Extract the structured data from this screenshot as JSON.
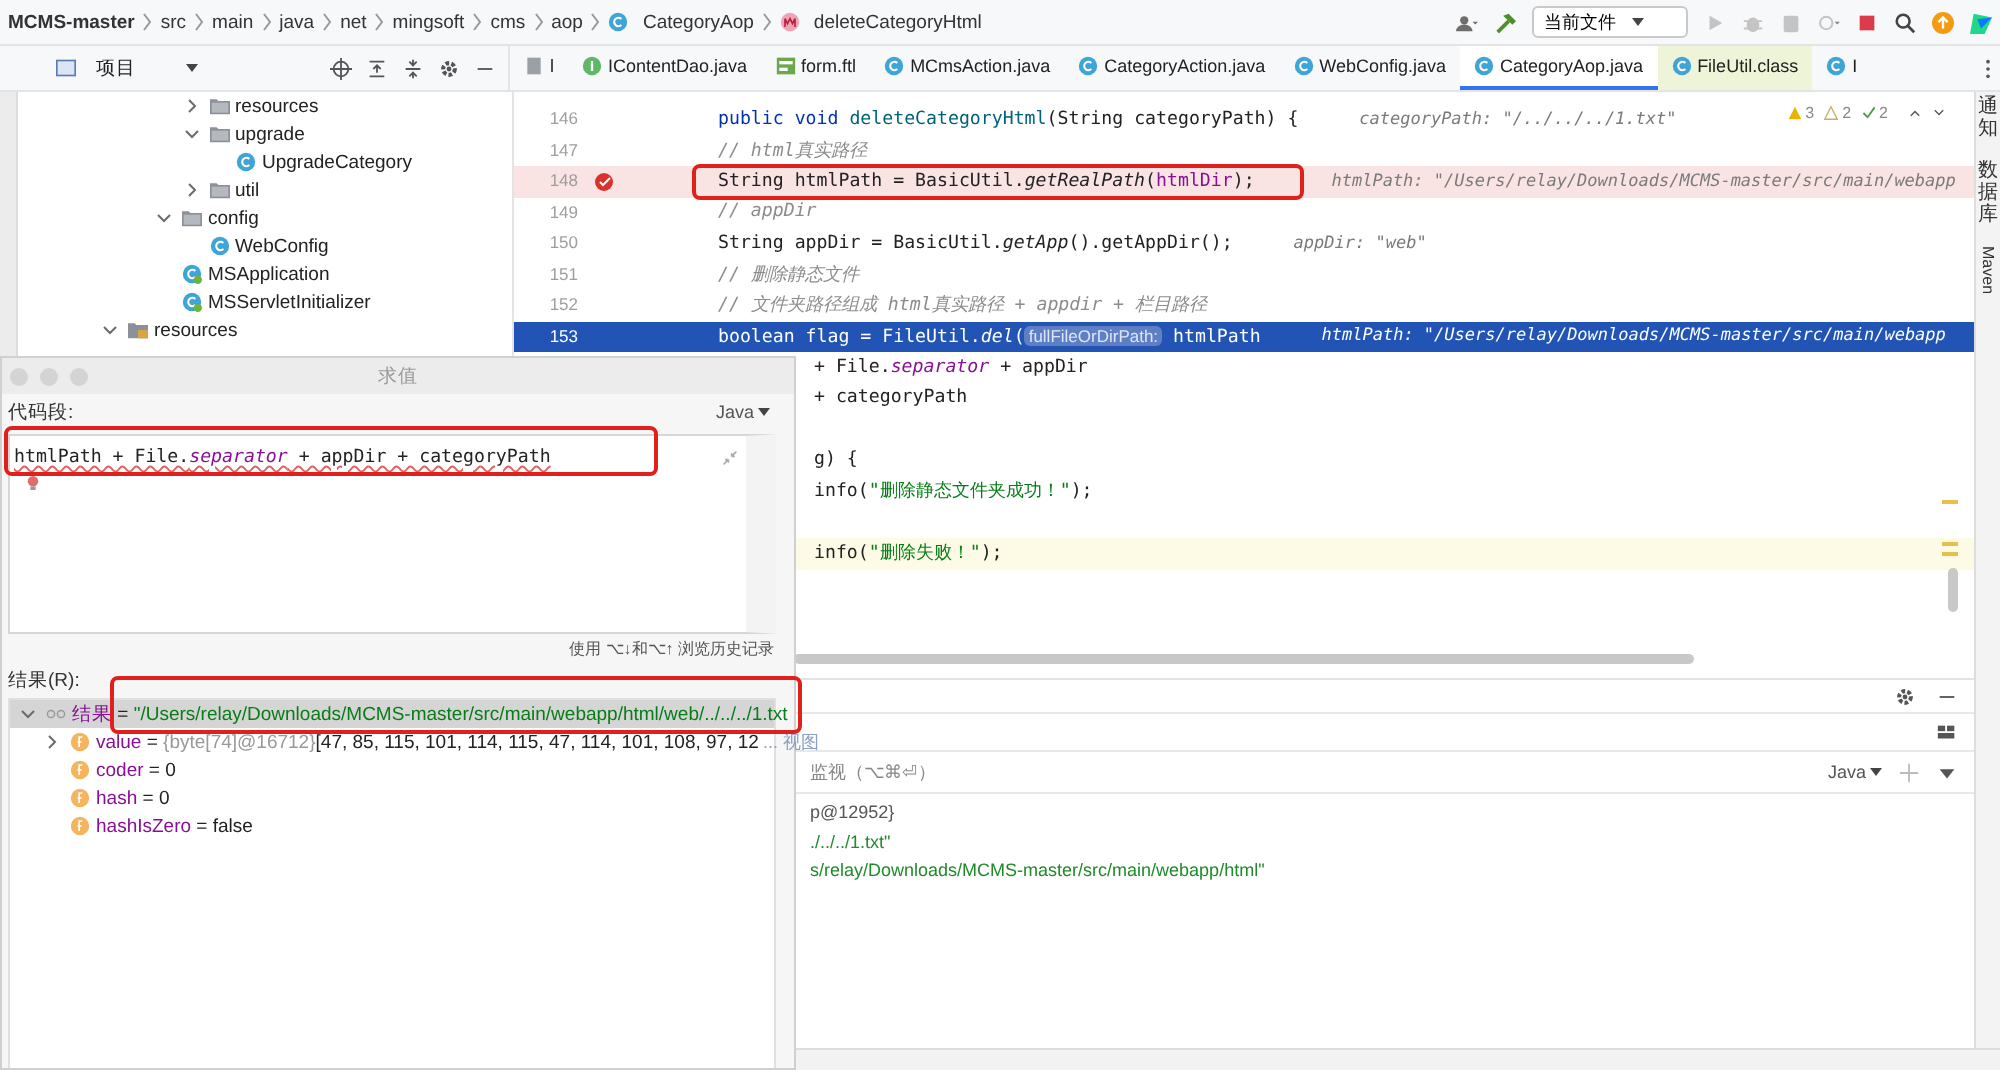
{
  "breadcrumb": [
    {
      "label": "MCMS-master",
      "kind": "root"
    },
    {
      "label": "src",
      "kind": "dir"
    },
    {
      "label": "main",
      "kind": "dir"
    },
    {
      "label": "java",
      "kind": "dir"
    },
    {
      "label": "net",
      "kind": "dir"
    },
    {
      "label": "mingsoft",
      "kind": "dir"
    },
    {
      "label": "cms",
      "kind": "dir"
    },
    {
      "label": "aop",
      "kind": "dir"
    },
    {
      "label": "CategoryAop",
      "kind": "class"
    },
    {
      "label": "deleteCategoryHtml",
      "kind": "method"
    }
  ],
  "run_config": {
    "label": "当前文件"
  },
  "project_panel": {
    "title": "项目"
  },
  "editor_tabs": [
    {
      "label": "l",
      "kind": "generic",
      "selected": false,
      "library": false
    },
    {
      "label": "IContentDao.java",
      "kind": "interface",
      "selected": false,
      "library": false
    },
    {
      "label": "form.ftl",
      "kind": "template",
      "selected": false,
      "library": false
    },
    {
      "label": "MCmsAction.java",
      "kind": "class",
      "selected": false,
      "library": false
    },
    {
      "label": "CategoryAction.java",
      "kind": "class",
      "selected": false,
      "library": false
    },
    {
      "label": "WebConfig.java",
      "kind": "class",
      "selected": false,
      "library": false
    },
    {
      "label": "CategoryAop.java",
      "kind": "class",
      "selected": true,
      "library": false
    },
    {
      "label": "FileUtil.class",
      "kind": "class",
      "selected": false,
      "library": true
    },
    {
      "label": "I",
      "kind": "class",
      "selected": false,
      "library": false
    }
  ],
  "tree": [
    {
      "children": [
        {
          "children": [
            {
              "children": [
                {
                  "label": "resources",
                  "kind": "folder",
                  "expanded": false
                },
                {
                  "label": "upgrade",
                  "kind": "folder",
                  "expanded": true,
                  "children": [
                    {
                      "label": "UpgradeCategory",
                      "kind": "class"
                    }
                  ]
                },
                {
                  "label": "util",
                  "kind": "folder",
                  "expanded": false
                }
              ]
            },
            {
              "label": "config",
              "kind": "folder",
              "expanded": true,
              "children": [
                {
                  "label": "WebConfig",
                  "kind": "class"
                }
              ]
            },
            {
              "label": "MSApplication",
              "kind": "app"
            },
            {
              "label": "MSServletInitializer",
              "kind": "app"
            }
          ]
        }
      ]
    },
    {
      "label": "resources",
      "kind": "resources",
      "expanded": true
    }
  ],
  "inspections": {
    "warnings": "3",
    "weak_warnings": "2",
    "passed": "2"
  },
  "code_lines": [
    {
      "number": "146",
      "kind": "signature",
      "tokens": [
        {
          "text": "public void ",
          "kind": "kw"
        },
        {
          "text": "deleteCategoryHtml",
          "kind": "decl"
        },
        {
          "text": "(String categoryPath) {   ",
          "kind": "plain"
        },
        {
          "text": "categoryPath: \"/../../../1.txt\"",
          "kind": "hint"
        }
      ]
    },
    {
      "number": "147",
      "kind": "body",
      "tokens": [
        {
          "text": "// html真实路径",
          "kind": "comment"
        }
      ]
    },
    {
      "number": "148",
      "kind": "breakpoint",
      "tokens": [
        {
          "text": "String htmlPath = BasicUtil.",
          "kind": "plain"
        },
        {
          "text": "getRealPath",
          "kind": "static"
        },
        {
          "text": "(",
          "kind": "plain"
        },
        {
          "text": "htmlDir",
          "kind": "field"
        },
        {
          "text": ");   ",
          "kind": "plain"
        },
        {
          "text": "htmlPath: \"/Users/relay/Downloads/MCMS-master/src/main/webapp",
          "kind": "hint"
        }
      ]
    },
    {
      "number": "149",
      "kind": "body",
      "tokens": [
        {
          "text": "// appDir",
          "kind": "comment"
        }
      ]
    },
    {
      "number": "150",
      "kind": "body",
      "tokens": [
        {
          "text": "String appDir = BasicUtil.",
          "kind": "plain"
        },
        {
          "text": "getApp",
          "kind": "static"
        },
        {
          "text": "().getAppDir();   ",
          "kind": "plain"
        },
        {
          "text": "appDir: \"web\"",
          "kind": "hint"
        }
      ]
    },
    {
      "number": "151",
      "kind": "body",
      "tokens": [
        {
          "text": "// 删除静态文件",
          "kind": "comment"
        }
      ]
    },
    {
      "number": "152",
      "kind": "body",
      "tokens": [
        {
          "text": "// 文件夹路径组成 html真实路径 + appdir + 栏目路径",
          "kind": "comment"
        }
      ]
    },
    {
      "number": "153",
      "kind": "current",
      "tokens": [
        {
          "text": "boolean",
          "kind": "kw"
        },
        {
          "text": " flag = FileUtil.",
          "kind": "plain"
        },
        {
          "text": "del",
          "kind": "static"
        },
        {
          "text": "(",
          "kind": "plain"
        },
        {
          "text": "fullFileOrDirPath:",
          "kind": "param"
        },
        {
          "text": " htmlPath   ",
          "kind": "plain"
        },
        {
          "text": "htmlPath: \"/Users/relay/Downloads/MCMS-master/src/main/webapp",
          "kind": "hint"
        }
      ]
    },
    {
      "kind": "covered",
      "tokens": [
        {
          "text": "+ File.",
          "kind": "plain"
        },
        {
          "text": "separator",
          "kind": "staticfield"
        },
        {
          "text": " + appDir",
          "kind": "plain"
        }
      ]
    },
    {
      "kind": "covered",
      "tokens": [
        {
          "text": "+ categoryPath",
          "kind": "plain"
        }
      ]
    },
    {
      "kind": "covered"
    },
    {
      "kind": "covered",
      "tokens": [
        {
          "text": "g) {",
          "kind": "plain"
        }
      ]
    },
    {
      "kind": "covered",
      "tokens": [
        {
          "text": "info(",
          "kind": "plain"
        },
        {
          "text": "\"删除静态文件夹成功！\"",
          "kind": "string"
        },
        {
          "text": ");",
          "kind": "plain"
        }
      ]
    },
    {
      "kind": "covered"
    },
    {
      "kind": "caret",
      "tokens": [
        {
          "text": "info(",
          "kind": "plain"
        },
        {
          "text": "\"删除失败！\"",
          "kind": "string"
        },
        {
          "text": ");",
          "kind": "plain"
        }
      ]
    }
  ],
  "evaluate_dialog": {
    "title": "求值",
    "code_label": "代码段:",
    "language": "Java",
    "expression": [
      {
        "text": "htmlPath + File.",
        "kind": "plain"
      },
      {
        "text": "separator",
        "kind": "staticfield"
      },
      {
        "text": " + appDir + categoryPath",
        "kind": "plain"
      }
    ],
    "history_hint": "使用 ⌥↓和⌥↑ 浏览历史记录",
    "result_label": "结果(R):",
    "result": {
      "name": "结果",
      "operator": "=",
      "value": "\"/Users/relay/Downloads/MCMS-master/src/main/webapp/html/web/../../../1.txt",
      "expanded": true,
      "children": [
        {
          "name": "value",
          "operator": "=",
          "ref": "{byte[74]@16712}",
          "value": "[47, 85, 115, 101, 114, 115, 47, 114, 101, 108, 97, 12",
          "link": "... 视图",
          "expanded": false
        },
        {
          "name": "coder",
          "operator": "=",
          "value": "0"
        },
        {
          "name": "hash",
          "operator": "=",
          "value": "0"
        },
        {
          "name": "hashIsZero",
          "operator": "=",
          "value": "false"
        }
      ]
    }
  },
  "debug_panel": {
    "watch_hint": "监视（⌥⌘⏎）",
    "language": "Java",
    "lines": [
      {
        "text": "p@12952}",
        "kind": "object"
      },
      {
        "text": "./../../1.txt\"",
        "kind": "string"
      },
      {
        "text": "s/relay/Downloads/MCMS-master/src/main/webapp/html\"",
        "kind": "string"
      }
    ]
  },
  "right_strip": [
    {
      "label": "通知",
      "kind": "cjk"
    },
    {
      "label": "数据库",
      "kind": "cjk"
    },
    {
      "label": "Maven",
      "kind": "latin"
    }
  ]
}
